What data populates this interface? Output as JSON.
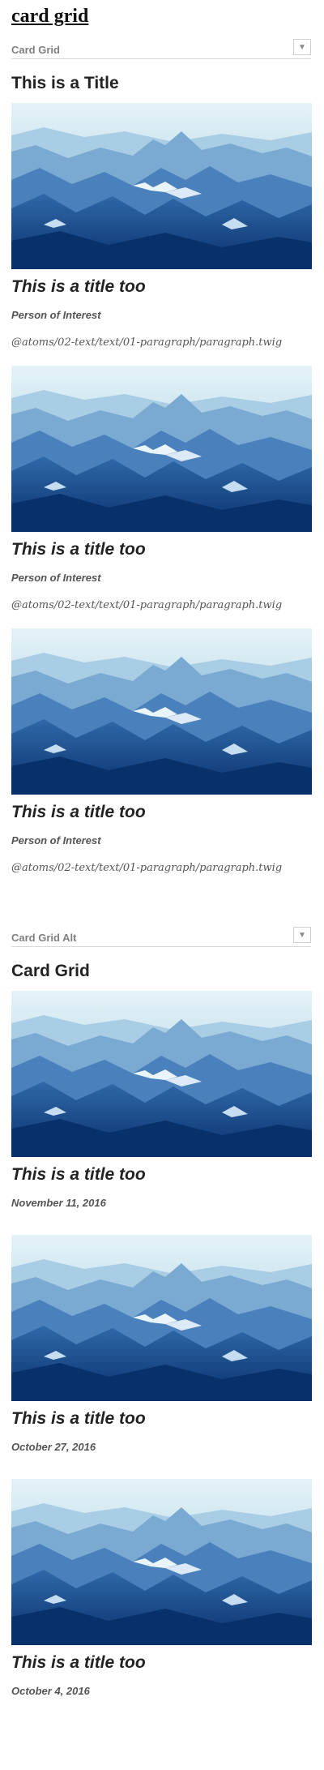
{
  "page": {
    "title": "card grid"
  },
  "sections": [
    {
      "label": "Card Grid",
      "toggle_icon": "▼",
      "heading": "This is a Title",
      "cards": [
        {
          "title": "This is a title too",
          "subtitle": "Person of Interest",
          "path": "@atoms/02-text/text/01-paragraph/paragraph.twig"
        },
        {
          "title": "This is a title too",
          "subtitle": "Person of Interest",
          "path": "@atoms/02-text/text/01-paragraph/paragraph.twig"
        },
        {
          "title": "This is a title too",
          "subtitle": "Person of Interest",
          "path": "@atoms/02-text/text/01-paragraph/paragraph.twig"
        }
      ]
    },
    {
      "label": "Card Grid Alt",
      "toggle_icon": "▼",
      "heading": "Card Grid",
      "cards": [
        {
          "title": "This is a title too",
          "date": "November 11, 2016"
        },
        {
          "title": "This is a title too",
          "date": "October 27, 2016"
        },
        {
          "title": "This is a title too",
          "date": "October 4, 2016"
        }
      ]
    }
  ],
  "image": {
    "subject": "blue-mountain-landscape",
    "sky_color": "#cfe8f2",
    "shadow_color": "#0b3a7a"
  }
}
